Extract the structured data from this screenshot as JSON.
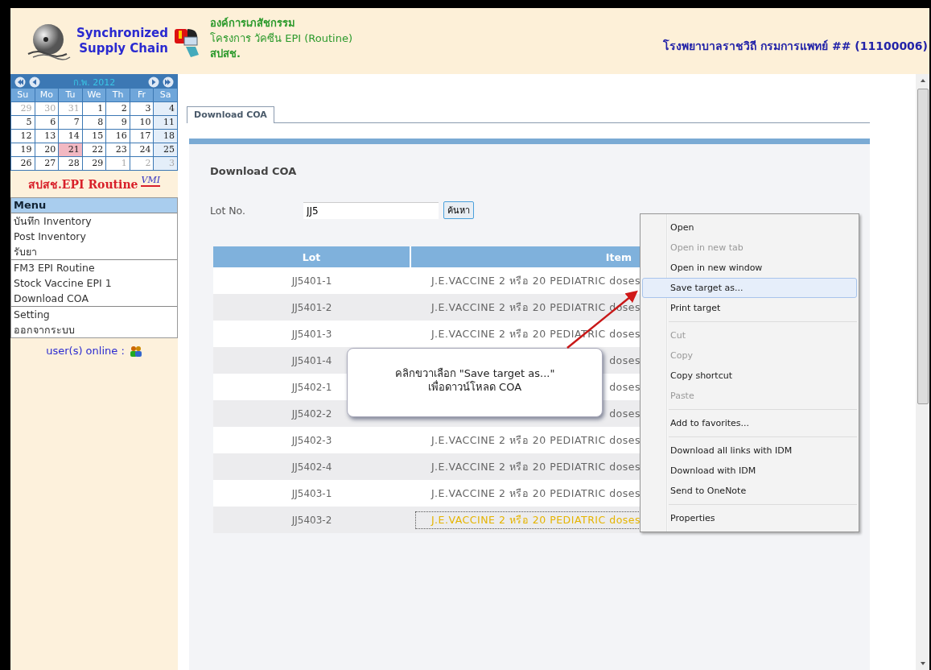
{
  "header": {
    "app_name_lines": [
      "Synchronized",
      "Supply Chain"
    ],
    "org_lines": [
      {
        "text": "องค์การเภสัชกรรม",
        "bold": true
      },
      {
        "text": "โครงการ วัคซีน EPI (Routine)",
        "bold": false
      },
      {
        "text": "สปสช.",
        "bold": true
      }
    ],
    "hospital": "โรงพยาบาลราชวิถี กรมการแพทย์ ## (11100006)"
  },
  "calendar": {
    "month_label": "ก.พ. 2012",
    "weekdays": [
      "Su",
      "Mo",
      "Tu",
      "We",
      "Th",
      "Fr",
      "Sa"
    ],
    "weeks": [
      {
        "days": [
          {
            "day": "29",
            "other_month": true,
            "selected": false
          },
          {
            "day": "30",
            "other_month": true,
            "selected": false
          },
          {
            "day": "31",
            "other_month": true,
            "selected": false
          },
          {
            "day": "1",
            "other_month": false,
            "selected": false
          },
          {
            "day": "2",
            "other_month": false,
            "selected": false
          },
          {
            "day": "3",
            "other_month": false,
            "selected": false
          },
          {
            "day": "4",
            "other_month": false,
            "selected": false
          }
        ]
      },
      {
        "days": [
          {
            "day": "5",
            "other_month": false,
            "selected": false
          },
          {
            "day": "6",
            "other_month": false,
            "selected": false
          },
          {
            "day": "7",
            "other_month": false,
            "selected": false
          },
          {
            "day": "8",
            "other_month": false,
            "selected": false
          },
          {
            "day": "9",
            "other_month": false,
            "selected": false
          },
          {
            "day": "10",
            "other_month": false,
            "selected": false
          },
          {
            "day": "11",
            "other_month": false,
            "selected": false
          }
        ]
      },
      {
        "days": [
          {
            "day": "12",
            "other_month": false,
            "selected": false
          },
          {
            "day": "13",
            "other_month": false,
            "selected": false
          },
          {
            "day": "14",
            "other_month": false,
            "selected": false
          },
          {
            "day": "15",
            "other_month": false,
            "selected": false
          },
          {
            "day": "16",
            "other_month": false,
            "selected": false
          },
          {
            "day": "17",
            "other_month": false,
            "selected": false
          },
          {
            "day": "18",
            "other_month": false,
            "selected": false
          }
        ]
      },
      {
        "days": [
          {
            "day": "19",
            "other_month": false,
            "selected": false
          },
          {
            "day": "20",
            "other_month": false,
            "selected": false
          },
          {
            "day": "21",
            "other_month": false,
            "selected": true
          },
          {
            "day": "22",
            "other_month": false,
            "selected": false
          },
          {
            "day": "23",
            "other_month": false,
            "selected": false
          },
          {
            "day": "24",
            "other_month": false,
            "selected": false
          },
          {
            "day": "25",
            "other_month": false,
            "selected": false
          }
        ]
      },
      {
        "days": [
          {
            "day": "26",
            "other_month": false,
            "selected": false
          },
          {
            "day": "27",
            "other_month": false,
            "selected": false
          },
          {
            "day": "28",
            "other_month": false,
            "selected": false
          },
          {
            "day": "29",
            "other_month": false,
            "selected": false
          },
          {
            "day": "1",
            "other_month": true,
            "selected": false
          },
          {
            "day": "2",
            "other_month": true,
            "selected": false
          },
          {
            "day": "3",
            "other_month": true,
            "selected": false
          }
        ]
      }
    ]
  },
  "program_banner": {
    "title": "สปสช.EPI Routine",
    "badge": "VMI"
  },
  "sidebar_menu": {
    "title": "Menu",
    "groups": [
      {
        "items": [
          {
            "label": "บันทึก Inventory",
            "selected": false
          },
          {
            "label": "Post Inventory",
            "selected": false
          },
          {
            "label": "รับยา",
            "selected": false
          }
        ]
      },
      {
        "items": [
          {
            "label": "FM3 EPI Routine",
            "selected": false
          },
          {
            "label": "Stock Vaccine EPI 1",
            "selected": false
          },
          {
            "label": "Download COA",
            "selected": false
          }
        ]
      },
      {
        "items": [
          {
            "label": "Setting",
            "selected": false
          },
          {
            "label": "ออกจากระบบ",
            "selected": false
          }
        ]
      }
    ]
  },
  "users_online": "user(s) online :",
  "tabs": [
    {
      "label": "Download COA",
      "selected": true
    }
  ],
  "panel": {
    "title": "Download COA",
    "lot_label": "Lot No.",
    "lot_value": "JJ5",
    "search_button": "ค้นหา"
  },
  "table": {
    "columns": [
      "Lot",
      "Item"
    ],
    "rows": [
      {
        "lot": "JJ5401-1",
        "item": "J.E.VACCINE 2 หรือ 20 PEDIATRIC doses",
        "focused": false
      },
      {
        "lot": "JJ5401-2",
        "item": "J.E.VACCINE 2 หรือ 20 PEDIATRIC doses",
        "focused": false
      },
      {
        "lot": "JJ5401-3",
        "item": "J.E.VACCINE 2 หรือ 20 PEDIATRIC doses",
        "focused": false
      },
      {
        "lot": "JJ5401-4",
        "item": "doses",
        "focused": false
      },
      {
        "lot": "JJ5402-1",
        "item": "doses",
        "focused": false
      },
      {
        "lot": "JJ5402-2",
        "item": "doses",
        "focused": false
      },
      {
        "lot": "JJ5402-3",
        "item": "J.E.VACCINE 2 หรือ 20 PEDIATRIC doses",
        "focused": false
      },
      {
        "lot": "JJ5402-4",
        "item": "J.E.VACCINE 2 หรือ 20 PEDIATRIC doses",
        "focused": false
      },
      {
        "lot": "JJ5403-1",
        "item": "J.E.VACCINE 2 หรือ 20 PEDIATRIC doses",
        "focused": false
      },
      {
        "lot": "JJ5403-2",
        "item": "J.E.VACCINE 2 หรือ 20 PEDIATRIC doses",
        "focused": true
      }
    ]
  },
  "callout": {
    "lines": [
      "คลิกขวาเลือก \"Save target as...\"",
      "เพื่อดาวน์โหลด COA"
    ]
  },
  "context_menu": {
    "groups": [
      {
        "items": [
          {
            "label": "Open",
            "disabled": false,
            "selected": false
          },
          {
            "label": "Open in new tab",
            "disabled": true,
            "selected": false
          },
          {
            "label": "Open in new window",
            "disabled": false,
            "selected": false
          },
          {
            "label": "Save target as...",
            "disabled": false,
            "selected": true
          },
          {
            "label": "Print target",
            "disabled": false,
            "selected": false
          }
        ]
      },
      {
        "items": [
          {
            "label": "Cut",
            "disabled": true,
            "selected": false
          },
          {
            "label": "Copy",
            "disabled": true,
            "selected": false
          },
          {
            "label": "Copy shortcut",
            "disabled": false,
            "selected": false
          },
          {
            "label": "Paste",
            "disabled": true,
            "selected": false
          }
        ]
      },
      {
        "items": [
          {
            "label": "Add to favorites...",
            "disabled": false,
            "selected": false
          }
        ]
      },
      {
        "items": [
          {
            "label": "Download all links with IDM",
            "disabled": false,
            "selected": false
          },
          {
            "label": "Download with IDM",
            "disabled": false,
            "selected": false
          },
          {
            "label": "Send to OneNote",
            "disabled": false,
            "selected": false
          }
        ]
      },
      {
        "items": [
          {
            "label": "Properties",
            "disabled": false,
            "selected": false
          }
        ]
      }
    ]
  }
}
